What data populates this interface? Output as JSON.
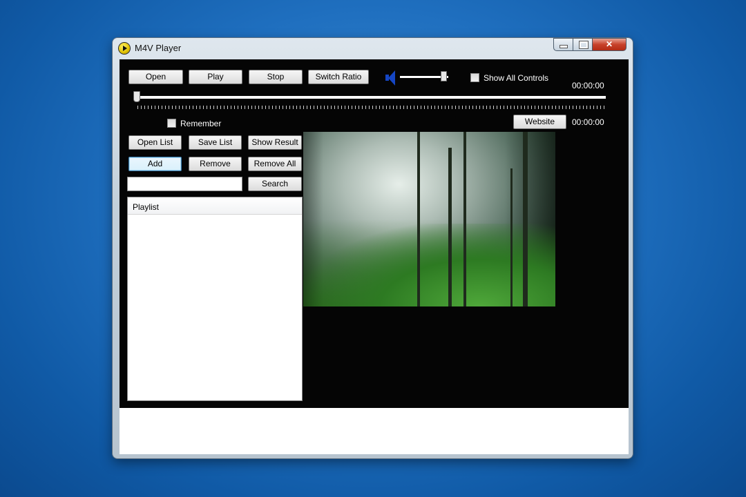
{
  "window": {
    "title": "M4V Player",
    "close_glyph": "✕"
  },
  "toolbar": {
    "open": "Open",
    "play": "Play",
    "stop": "Stop",
    "switch_ratio": "Switch Ratio",
    "show_all_controls": "Show All Controls",
    "time_top": "00:00:00",
    "volume_level": 0.95,
    "seek_position": 0.0
  },
  "options": {
    "remember": "Remember",
    "website": "Website",
    "time_bottom": "00:00:00"
  },
  "playlist_controls": {
    "open_list": "Open List",
    "save_list": "Save List",
    "show_result": "Show Result",
    "add": "Add",
    "remove": "Remove",
    "remove_all": "Remove All",
    "search": "Search",
    "search_value": ""
  },
  "playlist": {
    "header": "Playlist",
    "items": []
  },
  "icons": {
    "app": "play-circle-icon",
    "volume": "speaker-icon",
    "minimize": "minimize-icon",
    "maximize": "maximize-icon",
    "close": "close-icon"
  },
  "colors": {
    "client_bg": "#050505",
    "speaker": "#1546c4",
    "close_button": "#c7412a"
  }
}
